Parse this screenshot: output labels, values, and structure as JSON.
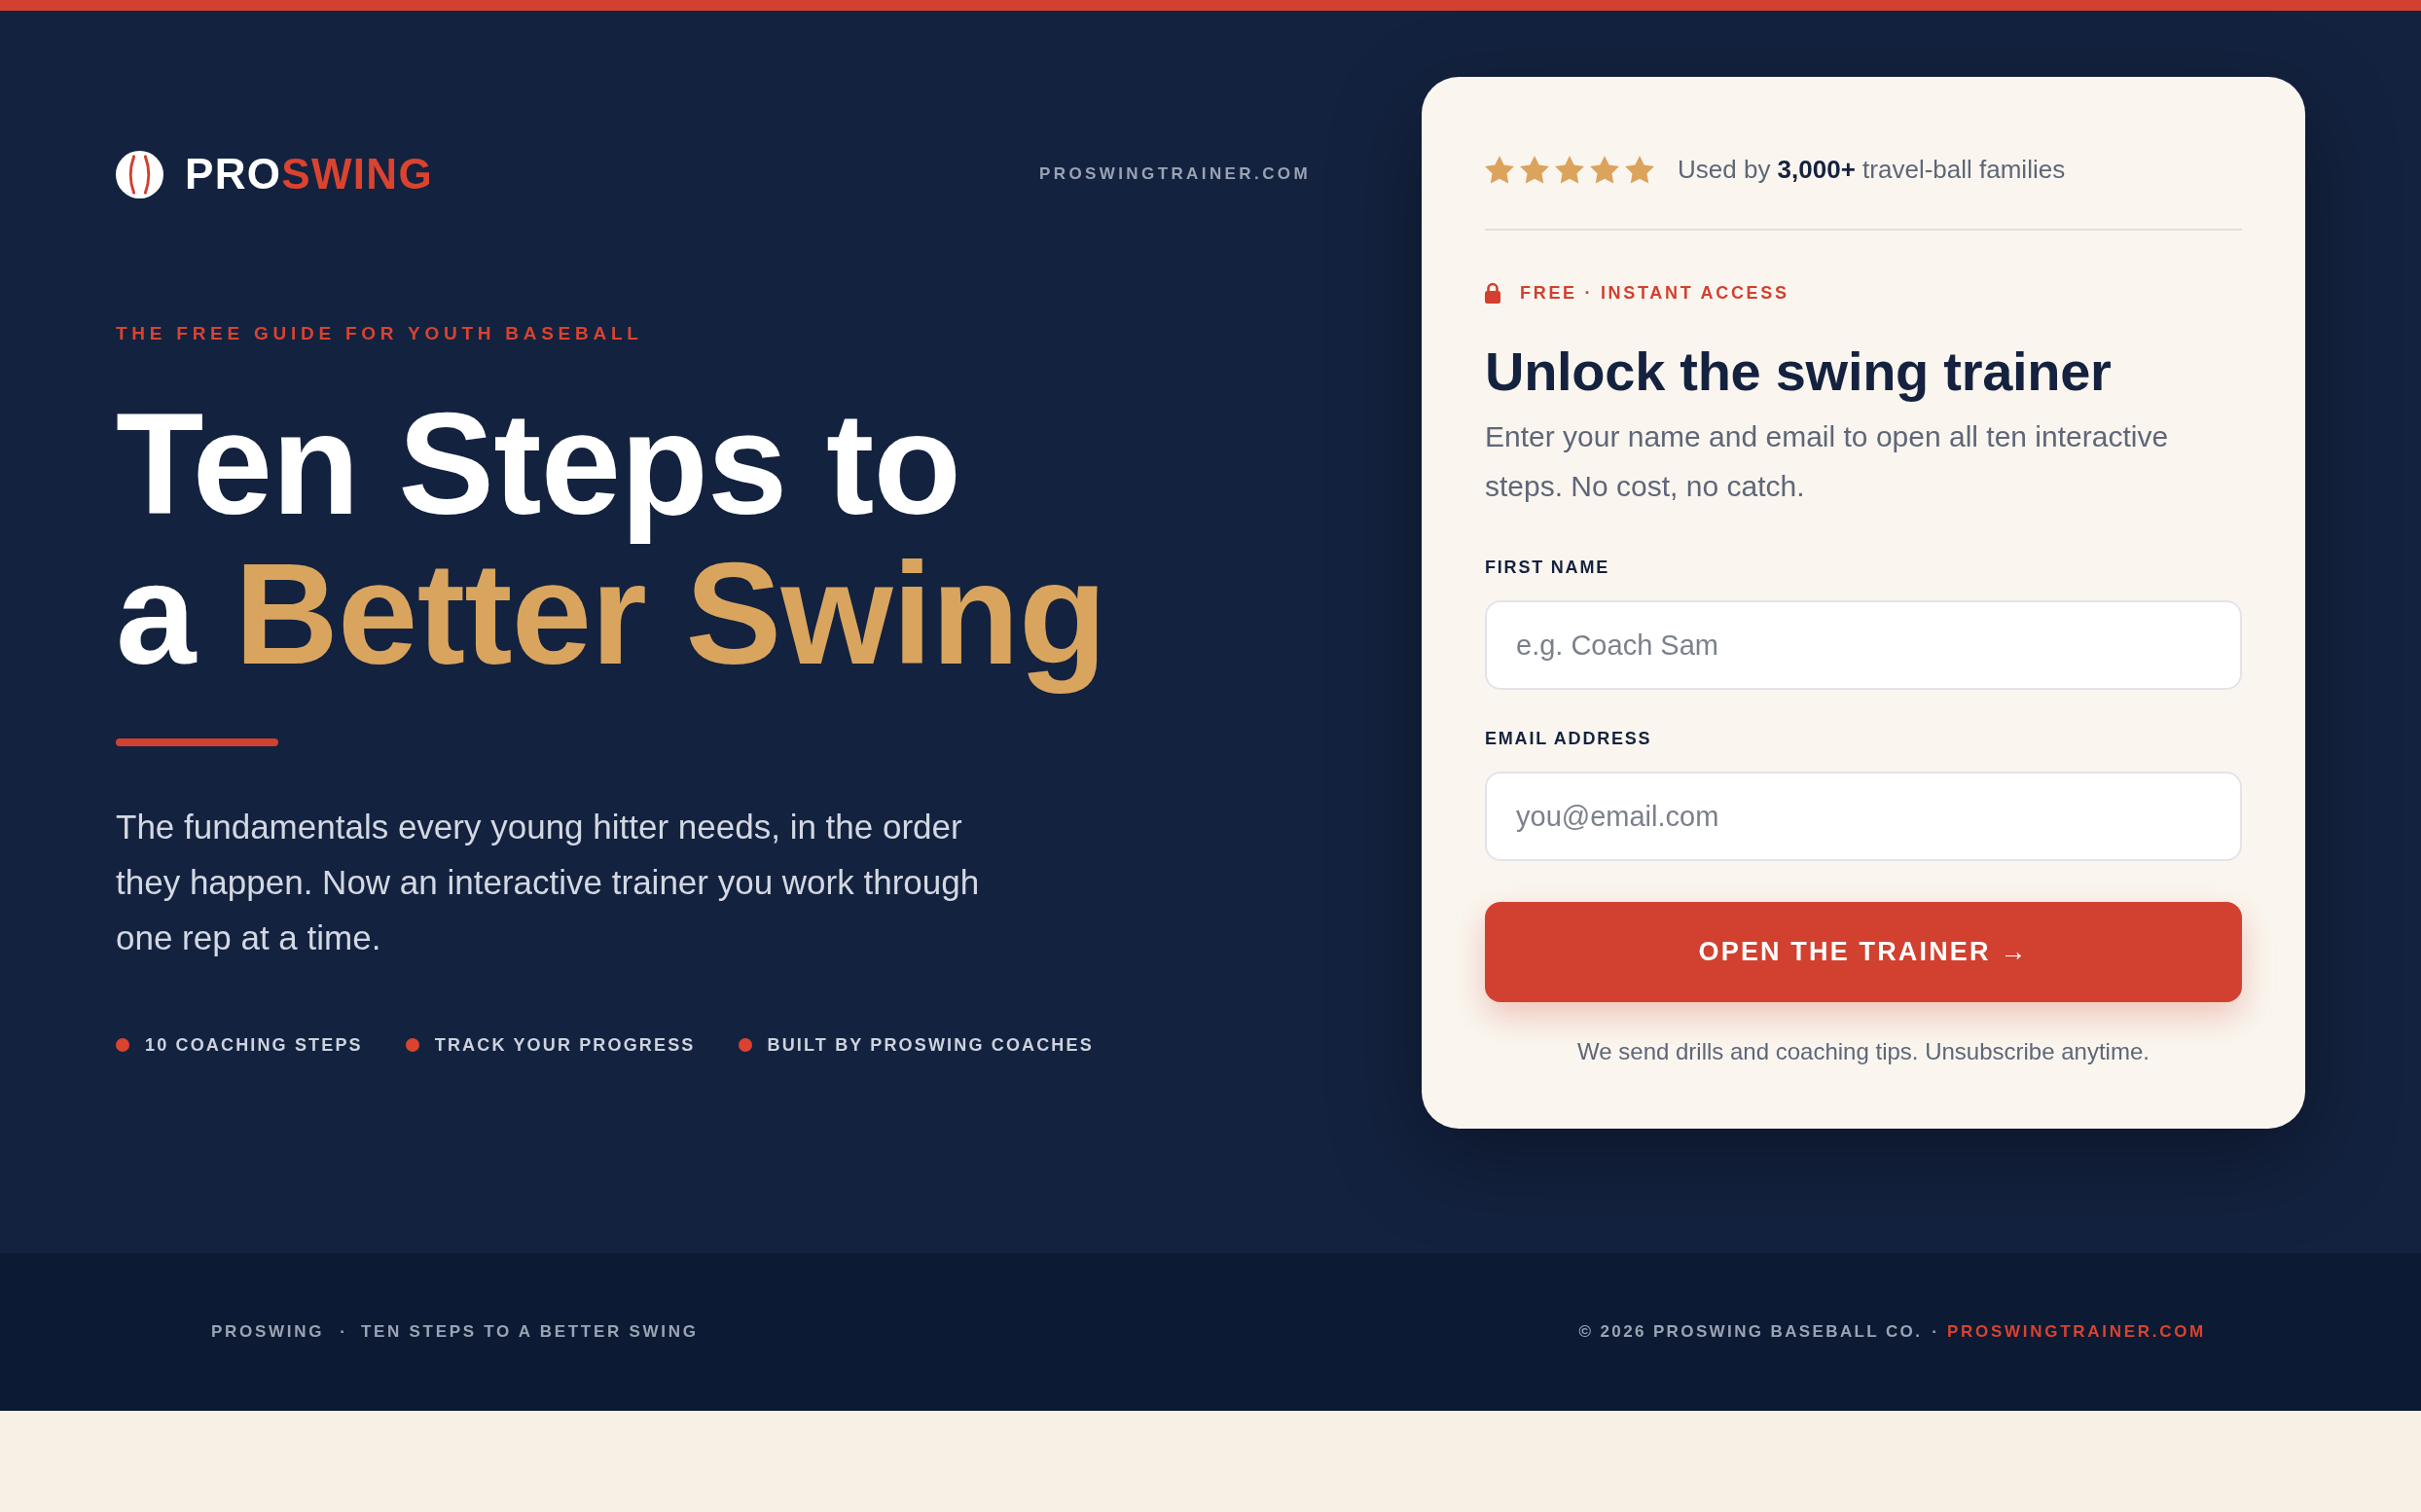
{
  "header": {
    "brand": [
      {
        "text": "PRO",
        "kind": "base"
      },
      {
        "text": "SWING",
        "kind": "accent"
      }
    ],
    "website": "PROSWINGTRAINER.COM"
  },
  "hero": {
    "eyebrow": "THE FREE GUIDE FOR YOUTH BASEBALL",
    "headline": {
      "lines": [
        {
          "parts": [
            {
              "text": "Ten Steps to",
              "kind": "base"
            }
          ]
        },
        {
          "parts": [
            {
              "text": "a",
              "kind": "base"
            },
            {
              "text": "Better Swing",
              "kind": "accent"
            }
          ]
        }
      ]
    },
    "intro": "The fundamentals every young hitter needs, in the order they happen. Now an interactive trainer you work through one rep at a time.",
    "highlights": [
      "10 COACHING STEPS",
      "TRACK YOUR PROGRESS",
      "BUILT BY PROSWING COACHES"
    ]
  },
  "signup_card": {
    "rating": {
      "stars": 5,
      "text": "Used by **3,000+** travel-ball families"
    },
    "badge": "FREE · INSTANT ACCESS",
    "title": "Unlock the swing trainer",
    "description": "Enter your name and email to open all ten interactive steps. No cost, no catch.",
    "fields": [
      {
        "label": "FIRST NAME",
        "placeholder": "e.g. Coach Sam"
      },
      {
        "label": "EMAIL ADDRESS",
        "placeholder": "you@email.com"
      }
    ],
    "submit": "OPEN THE TRAINER →",
    "note": "We send drills and coaching tips. Unsubscribe anytime."
  },
  "footer": {
    "brand": "PROSWING",
    "separator": "·",
    "tagline": "TEN STEPS TO A BETTER SWING",
    "copyright": "© 2026 PROSWING BASEBALL CO.",
    "copyright_separator": "·",
    "link": "PROSWINGTRAINER.COM"
  }
}
